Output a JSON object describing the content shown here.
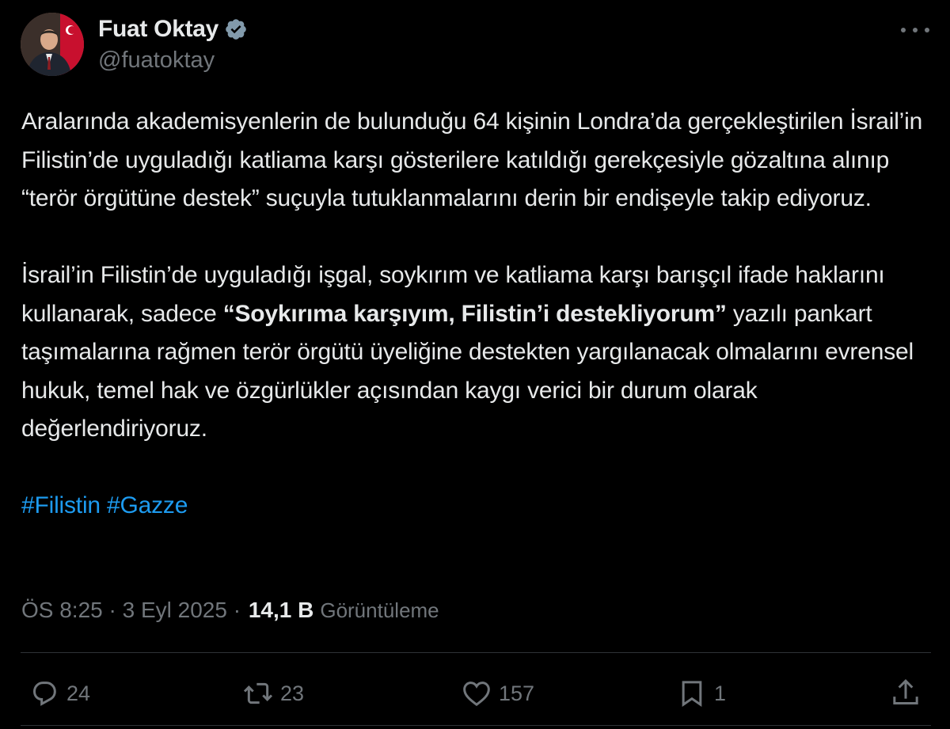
{
  "author": {
    "display_name": "Fuat Oktay",
    "handle": "@fuatoktay",
    "verified": true,
    "verified_color": "#71767b"
  },
  "tweet": {
    "p1": "Aralarında akademisyenlerin de  bulunduğu 64 kişinin Londra’da gerçekleştirilen İsrail’in Filistin’de uyguladığı katliama karşı gösterilere katıldığı gerekçesiyle gözaltına alınıp “terör örgütüne destek” suçuyla tutuklanmalarını derin bir endişeyle takip ediyoruz.",
    "p2_pre": "İsrail’in Filistin’de uyguladığı işgal, soykırım ve katliama karşı barışçıl ifade haklarını kullanarak, sadece ",
    "p2_bold": "“Soykırıma karşıyım, Filistin’i destekliyorum”",
    "p2_post": " yazılı pankart taşımalarına rağmen terör örgütü üyeliğine destekten yargılanacak olmalarını evrensel hukuk, temel hak ve özgürlükler açısından kaygı verici bir durum olarak değerlendiriyoruz.",
    "hashtags": [
      "#Filistin",
      "#Gazze"
    ],
    "hashtag_color": "#1d9bf0"
  },
  "meta": {
    "time": "ÖS 8:25",
    "date": "3 Eyl 2025",
    "separator": "·",
    "views_count": "14,1 B",
    "views_label": "Görüntüleme"
  },
  "actions": {
    "reply_count": "24",
    "repost_count": "23",
    "like_count": "157",
    "bookmark_count": "1"
  },
  "icons": [
    "avatar",
    "verified-badge-icon",
    "more-icon",
    "reply-icon",
    "repost-icon",
    "like-icon",
    "bookmark-icon",
    "share-icon"
  ]
}
